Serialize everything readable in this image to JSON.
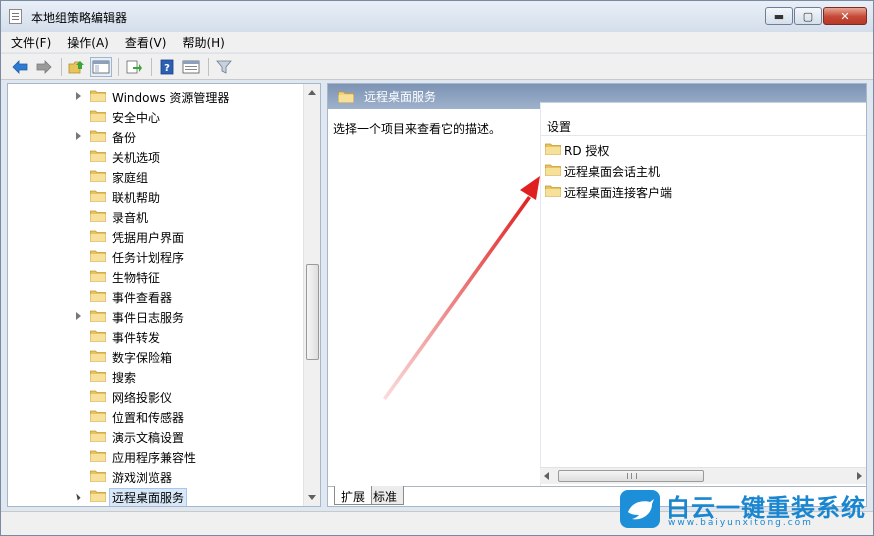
{
  "window": {
    "title": "本地组策略编辑器",
    "controls": {
      "minimize": "▬",
      "maximize": "▢",
      "close": "✕"
    }
  },
  "menu": [
    {
      "label": "文件(F)"
    },
    {
      "label": "操作(A)"
    },
    {
      "label": "查看(V)"
    },
    {
      "label": "帮助(H)"
    }
  ],
  "toolbar": {
    "buttons": [
      "back-icon",
      "forward-icon",
      "up-folder-icon",
      "show-hide-tree-icon",
      "export-list-icon",
      "help-icon",
      "properties-icon",
      "filter-icon"
    ]
  },
  "tree": {
    "items": [
      {
        "label": "Windows 资源管理器",
        "expandable": true
      },
      {
        "label": "安全中心",
        "expandable": false
      },
      {
        "label": "备份",
        "expandable": true
      },
      {
        "label": "关机选项",
        "expandable": false
      },
      {
        "label": "家庭组",
        "expandable": false
      },
      {
        "label": "联机帮助",
        "expandable": false
      },
      {
        "label": "录音机",
        "expandable": false
      },
      {
        "label": "凭据用户界面",
        "expandable": false
      },
      {
        "label": "任务计划程序",
        "expandable": false
      },
      {
        "label": "生物特征",
        "expandable": false
      },
      {
        "label": "事件查看器",
        "expandable": false
      },
      {
        "label": "事件日志服务",
        "expandable": true
      },
      {
        "label": "事件转发",
        "expandable": false
      },
      {
        "label": "数字保险箱",
        "expandable": false
      },
      {
        "label": "搜索",
        "expandable": false
      },
      {
        "label": "网络投影仪",
        "expandable": false
      },
      {
        "label": "位置和传感器",
        "expandable": false
      },
      {
        "label": "演示文稿设置",
        "expandable": false
      },
      {
        "label": "应用程序兼容性",
        "expandable": false
      },
      {
        "label": "游戏浏览器",
        "expandable": false
      },
      {
        "label": "远程桌面服务",
        "expandable": true,
        "expanded": true,
        "selected": true
      }
    ]
  },
  "right_pane": {
    "header_title": "远程桌面服务",
    "description": "选择一个项目来查看它的描述。",
    "column_header": "设置",
    "items": [
      {
        "label": "RD 授权"
      },
      {
        "label": "远程桌面会话主机"
      },
      {
        "label": "远程桌面连接客户端"
      }
    ]
  },
  "tabs": [
    {
      "label": "扩展",
      "active": true
    },
    {
      "label": "标准",
      "active": false
    }
  ],
  "watermark": {
    "title": "白云一键重装系统",
    "url": "www.baiyunxitong.com"
  },
  "colors": {
    "header_bg": "#8aa0bf",
    "folder_yellow": "#f2d27a",
    "arrow_red": "#e02020",
    "watermark_blue": "#1a86d0"
  }
}
